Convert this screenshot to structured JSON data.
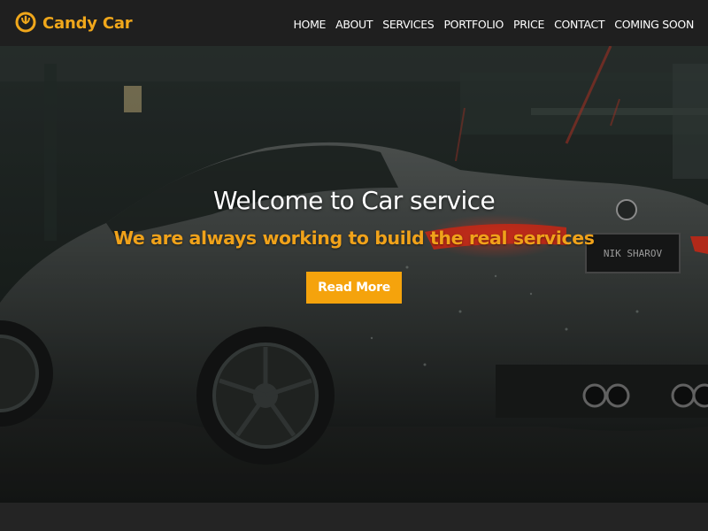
{
  "brand": {
    "name": "Candy Car",
    "icon": "location-pin-icon",
    "color": "#f0a71b"
  },
  "nav": {
    "items": [
      {
        "label": "HOME"
      },
      {
        "label": "ABOUT"
      },
      {
        "label": "SERVICES"
      },
      {
        "label": "PORTFOLIO"
      },
      {
        "label": "PRICE"
      },
      {
        "label": "CONTACT"
      },
      {
        "label": "COMING SOON"
      }
    ]
  },
  "hero": {
    "title": "Welcome to Car service",
    "subtitle": "We are always working to build the real services",
    "button_label": "Read More",
    "accent_color": "#f5a30c",
    "license_plate": "NIK SHAROV"
  }
}
